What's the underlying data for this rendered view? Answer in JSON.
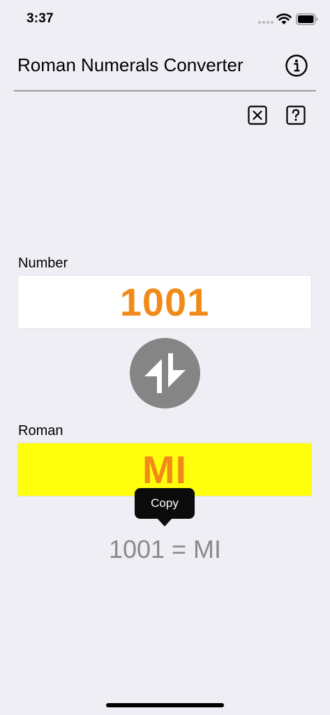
{
  "status_bar": {
    "time": "3:37",
    "icons": [
      "cellular-signal-icon",
      "wifi-icon",
      "battery-icon"
    ]
  },
  "header": {
    "title": "Roman Numerals Converter",
    "info_icon": "info-icon"
  },
  "toolbar": {
    "clear_icon": "clear-x-icon",
    "help_icon": "help-question-icon"
  },
  "number_section": {
    "label": "Number",
    "value": "1001"
  },
  "swap_icon": "swap-arrows-icon",
  "roman_section": {
    "label": "Roman",
    "value": "MI"
  },
  "context_menu": {
    "copy_label": "Copy"
  },
  "result": {
    "text": "1001 = MI"
  },
  "colors": {
    "background": "#efeef4",
    "accent_orange": "#f28a1a",
    "roman_field_bg": "#ffff0d",
    "swap_button_bg": "#858585",
    "result_gray": "#8a8a8e"
  }
}
